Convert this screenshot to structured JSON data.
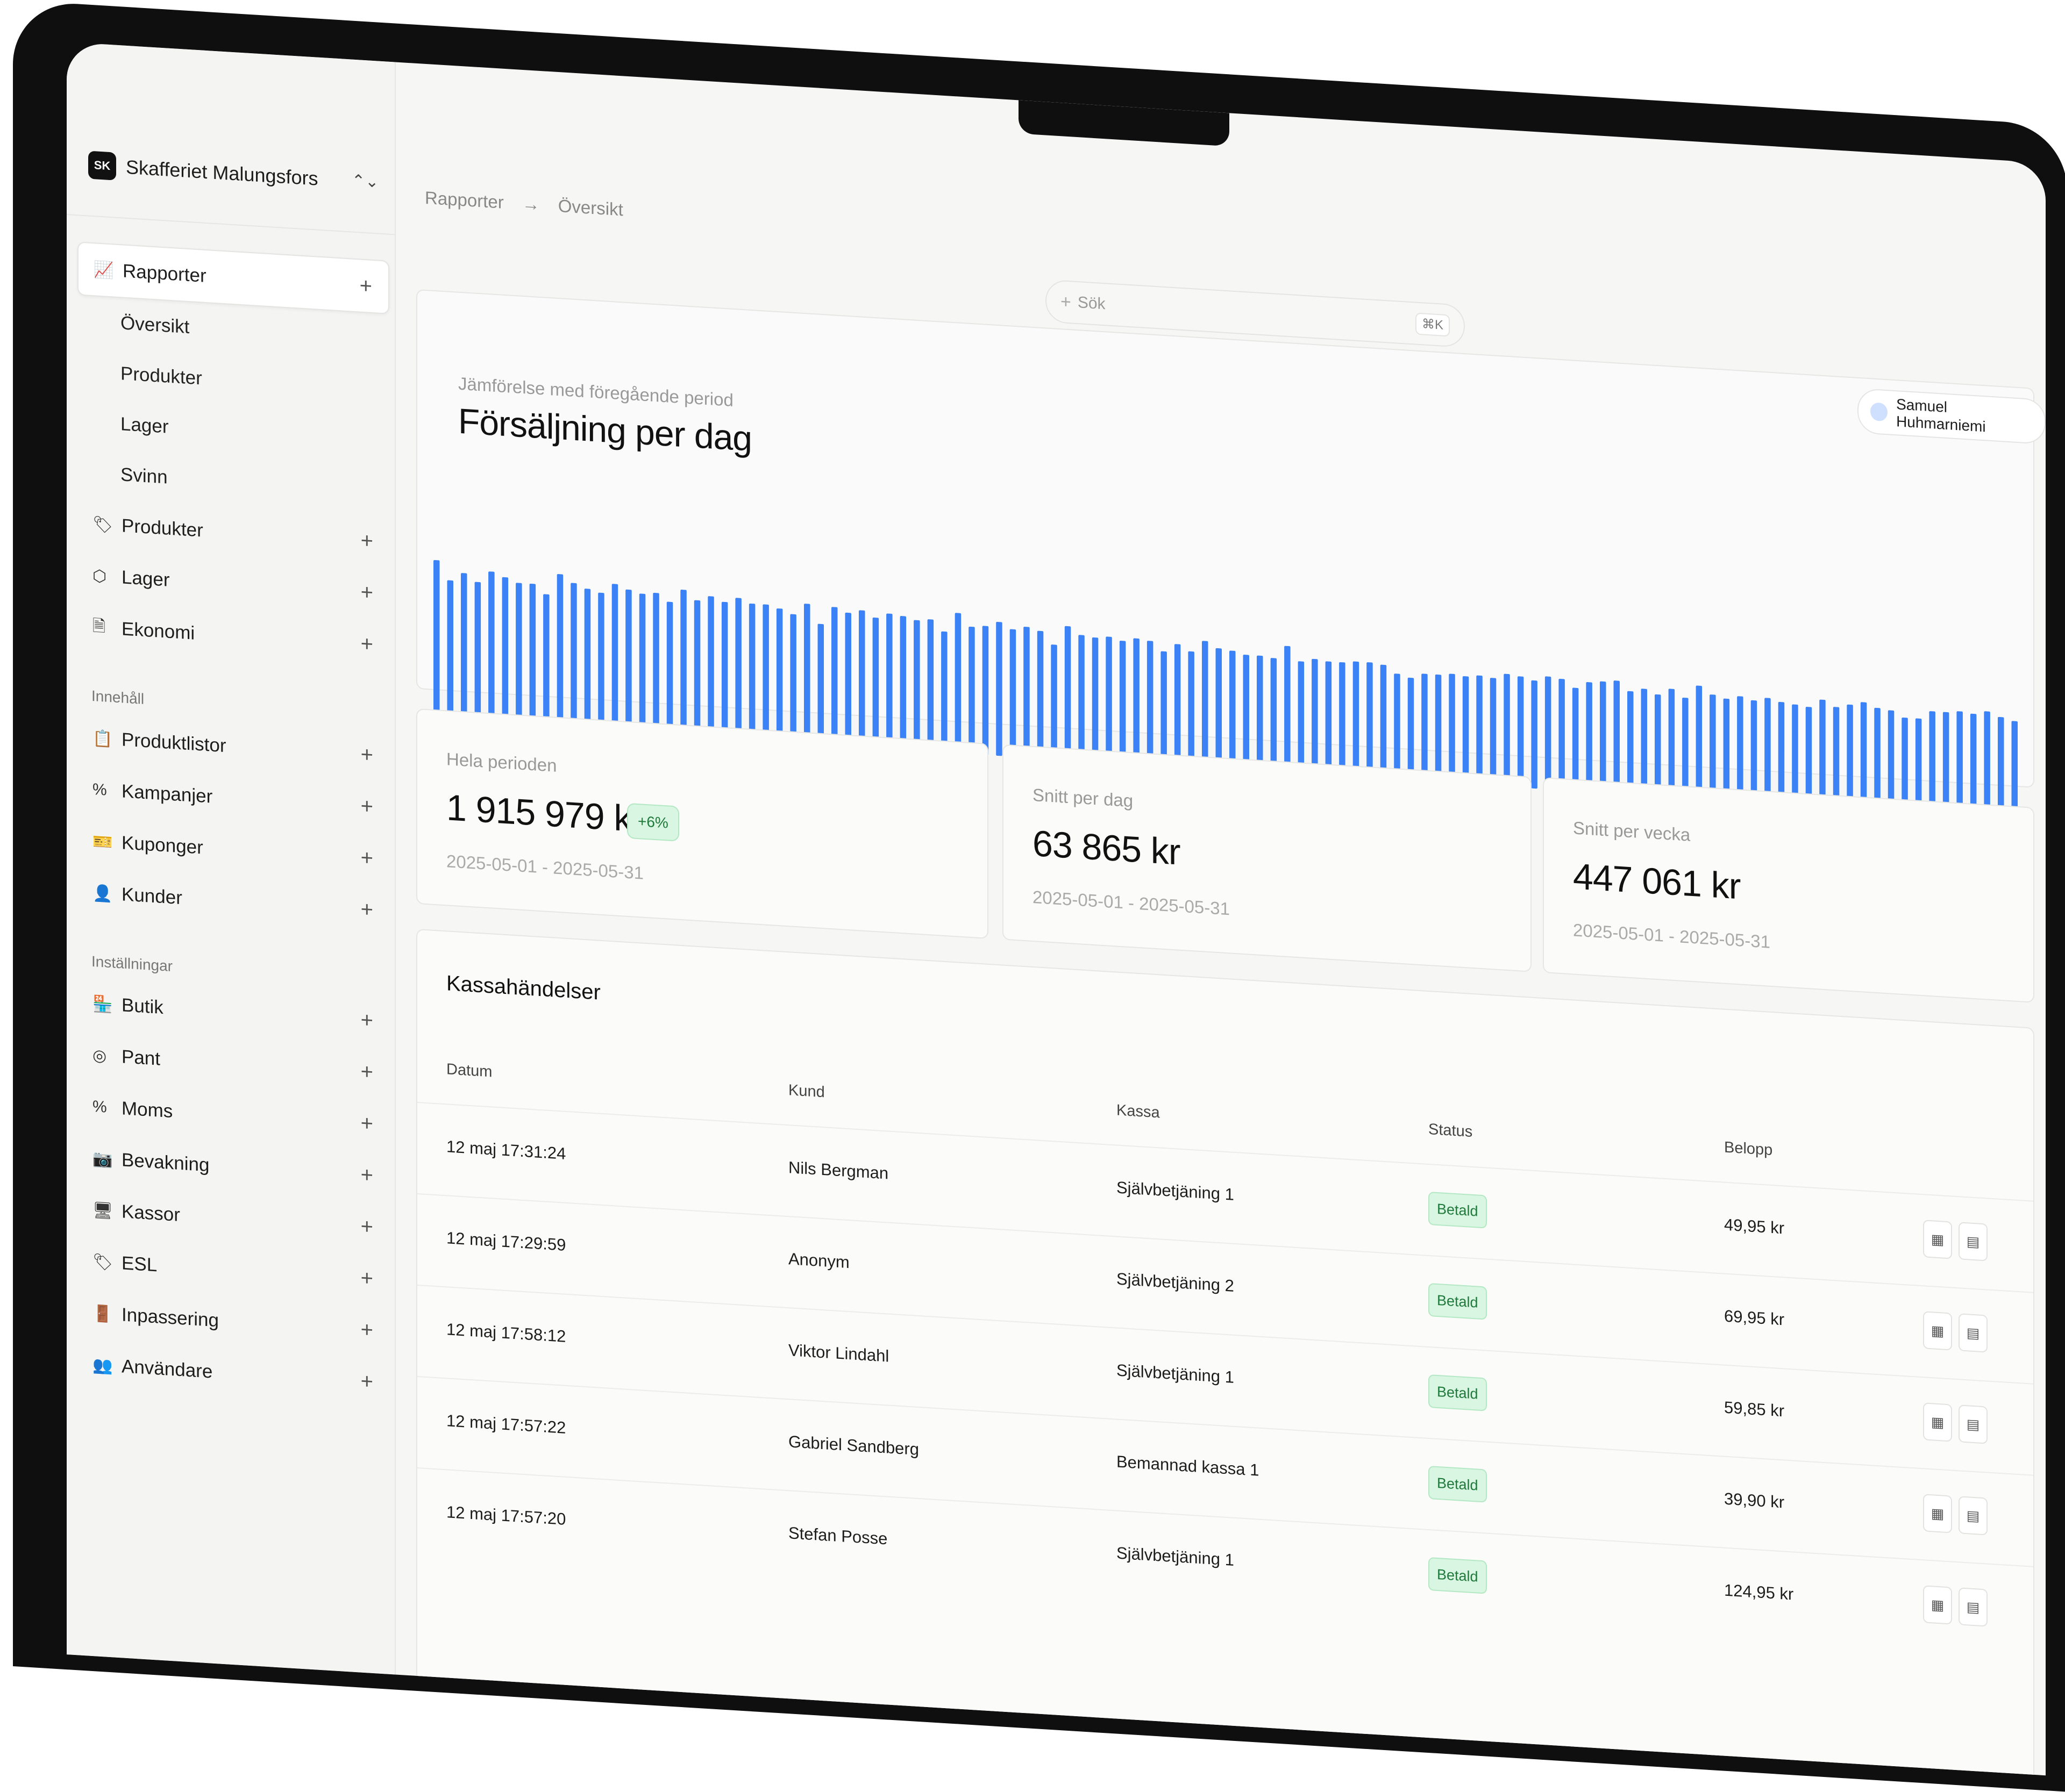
{
  "brand": {
    "badge": "SK",
    "name": "Skafferiet Malungsfors",
    "switch_icon": "⌃⌄"
  },
  "sidebar": {
    "plus": "+",
    "primary": [
      {
        "label": "Rapporter",
        "icon": "chart-line-icon",
        "glyph": "📈",
        "active": true,
        "children": [
          "Översikt",
          "Produkter",
          "Lager",
          "Svinn"
        ]
      },
      {
        "label": "Produkter",
        "icon": "tag-icon",
        "glyph": "🏷"
      },
      {
        "label": "Lager",
        "icon": "box-icon",
        "glyph": "⬡"
      },
      {
        "label": "Ekonomi",
        "icon": "document-icon",
        "glyph": "🗎"
      }
    ],
    "section_content": "Innehåll",
    "content": [
      {
        "label": "Produktlistor",
        "icon": "clipboard-icon",
        "glyph": "📋"
      },
      {
        "label": "Kampanjer",
        "icon": "percent-icon",
        "glyph": "%"
      },
      {
        "label": "Kuponger",
        "icon": "ticket-icon",
        "glyph": "🎫"
      },
      {
        "label": "Kunder",
        "icon": "contact-icon",
        "glyph": "👤"
      }
    ],
    "section_settings": "Inställningar",
    "settings": [
      {
        "label": "Butik",
        "icon": "store-icon",
        "glyph": "🏪"
      },
      {
        "label": "Pant",
        "icon": "coins-icon",
        "glyph": "◎"
      },
      {
        "label": "Moms",
        "icon": "percent-icon",
        "glyph": "%"
      },
      {
        "label": "Bevakning",
        "icon": "cctv-icon",
        "glyph": "📷"
      },
      {
        "label": "Kassor",
        "icon": "monitor-icon",
        "glyph": "🖥"
      },
      {
        "label": "ESL",
        "icon": "tags-icon",
        "glyph": "🏷"
      },
      {
        "label": "Inpassering",
        "icon": "door-icon",
        "glyph": "🚪"
      },
      {
        "label": "Användare",
        "icon": "users-icon",
        "glyph": "👥"
      }
    ]
  },
  "breadcrumb": {
    "root": "Rapporter",
    "arrow": "→",
    "current": "Översikt"
  },
  "search": {
    "plus": "+",
    "placeholder": "Sök",
    "shortcut": "⌘K"
  },
  "user": {
    "name": "Samuel Huhmarniemi"
  },
  "chart": {
    "subtitle": "Jämförelse med föregående period",
    "title": "Försäljning per dag"
  },
  "chart_data": {
    "type": "bar",
    "title": "Försäljning per dag",
    "xlabel": "",
    "ylabel": "",
    "color": "#3b82f6",
    "grid": false,
    "values": [
      100,
      88,
      93,
      88,
      95,
      92,
      89,
      89,
      83,
      96,
      91,
      88,
      86,
      92,
      89,
      87,
      88,
      83,
      91,
      85,
      88,
      85,
      88,
      85,
      85,
      83,
      80,
      87,
      75,
      86,
      83,
      85,
      81,
      84,
      83,
      81,
      82,
      75,
      87,
      79,
      80,
      83,
      79,
      81,
      79,
      71,
      83,
      78,
      77,
      78,
      76,
      78,
      77,
      71,
      76,
      72,
      79,
      75,
      74,
      72,
      72,
      71,
      79,
      70,
      72,
      71,
      71,
      72,
      72,
      71,
      66,
      64,
      67,
      67,
      68,
      67,
      68,
      67,
      70,
      69,
      67,
      70,
      69,
      64,
      68,
      69,
      70,
      64,
      66,
      63,
      67,
      62,
      70,
      65,
      63,
      65,
      63,
      65,
      63,
      62,
      61,
      66,
      62,
      64,
      66,
      63,
      62,
      58,
      58,
      63,
      63,
      64,
      63,
      65,
      62,
      60
    ]
  },
  "kpis": [
    {
      "label": "Hela perioden",
      "value": "1 915 979 kr",
      "badge": "+6%",
      "range": "2025-05-01 - 2025-05-31"
    },
    {
      "label": "Snitt per dag",
      "value": "63 865 kr",
      "range": "2025-05-01 - 2025-05-31"
    },
    {
      "label": "Snitt per vecka",
      "value": "447 061 kr",
      "range": "2025-05-01 - 2025-05-31"
    }
  ],
  "table": {
    "title": "Kassahändelser",
    "headers": {
      "datum": "Datum",
      "kund": "Kund",
      "kassa": "Kassa",
      "status": "Status",
      "belopp": "Belopp"
    },
    "rows": [
      {
        "datum": "12 maj 17:31:24",
        "kund": "Nils Bergman",
        "kassa": "Självbetjäning 1",
        "status": "Betald",
        "belopp": "49,95 kr"
      },
      {
        "datum": "12 maj 17:29:59",
        "kund": "Anonym",
        "kassa": "Självbetjäning 2",
        "status": "Betald",
        "belopp": "69,95 kr"
      },
      {
        "datum": "12 maj 17:58:12",
        "kund": "Viktor Lindahl",
        "kassa": "Självbetjäning 1",
        "status": "Betald",
        "belopp": "59,85 kr"
      },
      {
        "datum": "12 maj 17:57:22",
        "kund": "Gabriel Sandberg",
        "kassa": "Bemannad kassa 1",
        "status": "Betald",
        "belopp": "39,90 kr"
      },
      {
        "datum": "12 maj 17:57:20",
        "kund": "Stefan Posse",
        "kassa": "Självbetjäning 1",
        "status": "Betald",
        "belopp": "124,95 kr"
      }
    ],
    "row_actions": [
      {
        "icon": "film-icon",
        "glyph": "▦"
      },
      {
        "icon": "receipt-icon",
        "glyph": "▤"
      }
    ]
  }
}
